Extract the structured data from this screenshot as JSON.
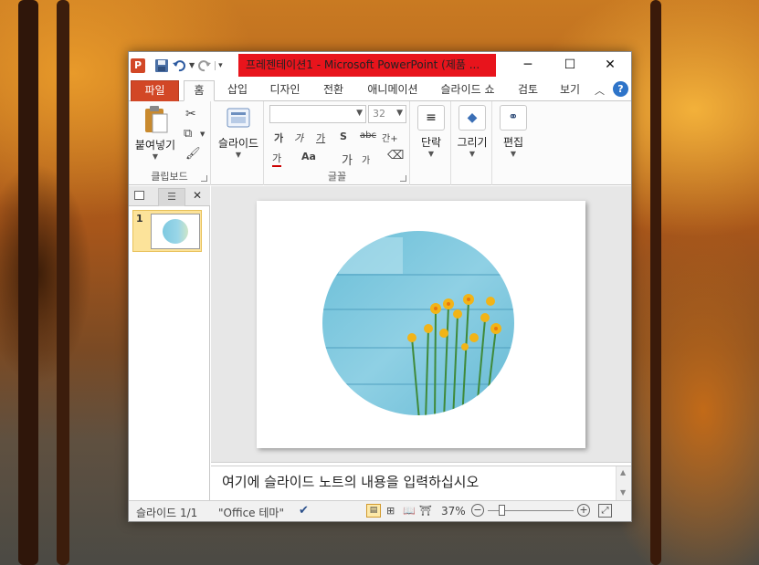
{
  "window": {
    "title": "프레젠테이션1 - Microsoft PowerPoint (제품 ...",
    "minimize": "─",
    "maximize": "☐",
    "close": "✕"
  },
  "qat": {
    "ppt_icon": "powerpoint-icon",
    "save_icon": "save-icon",
    "undo_icon": "undo-icon",
    "redo_icon": "redo-icon",
    "customize_icon": "customize-qat-icon"
  },
  "tabs": [
    {
      "label": "파일"
    },
    {
      "label": "홈"
    },
    {
      "label": "삽입"
    },
    {
      "label": "디자인"
    },
    {
      "label": "전환"
    },
    {
      "label": "애니메이션"
    },
    {
      "label": "슬라이드 쇼"
    },
    {
      "label": "검토"
    },
    {
      "label": "보기"
    }
  ],
  "ribbon": {
    "clipboard": {
      "paste_label": "붙여넣기",
      "group_label": "클립보드"
    },
    "slides": {
      "new_slide_label": "슬라이드"
    },
    "font": {
      "size": "32",
      "group_label": "글꼴",
      "bold": "가",
      "italic": "가",
      "underline": "가",
      "shadow": "S",
      "strike": "abc",
      "spacing": "간+",
      "case": "Aa",
      "grow": "가",
      "shrink": "가",
      "color": "가"
    },
    "paragraph": {
      "label": "단락"
    },
    "drawing": {
      "label": "그리기"
    },
    "editing": {
      "label": "편집"
    }
  },
  "panel": {
    "slide_number": "1"
  },
  "notes": {
    "placeholder": "여기에 슬라이드 노트의 내용을 입력하십시오"
  },
  "status": {
    "slide_info": "슬라이드 1/1",
    "theme": "\"Office 테마\"",
    "zoom": "37%"
  },
  "colors": {
    "file_tab": "#d24726",
    "title_highlight": "#e8141c",
    "thumb_selected": "#fce39a",
    "help_icon": "#2e74c9"
  }
}
